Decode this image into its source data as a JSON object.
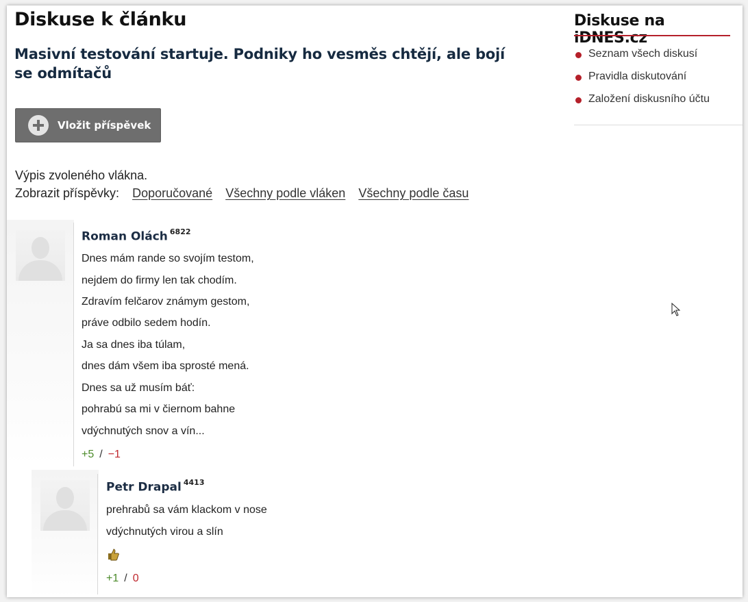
{
  "page": {
    "title": "Diskuse k článku",
    "article_title": "Masivní testování startuje. Podniky ho vesměs chtějí, ale bojí se odmítačů",
    "add_post_label": "Vložit příspěvek",
    "thread_note": "Výpis zvoleného vlákna.",
    "view_label": "Zobrazit příspěvky:",
    "view_links": [
      "Doporučované",
      "Všechny podle vláken",
      "Všechny podle času"
    ]
  },
  "comments": [
    {
      "author": "Roman Olách",
      "score": "6822",
      "lines": [
        "Dnes mám rande so svojím testom,",
        "nejdem do firmy len tak chodím.",
        "Zdravím felčarov známym gestom,",
        "práve odbilo sedem hodín.",
        "Ja sa dnes iba túlam,",
        "dnes dám všem iba sprosté mená.",
        "Dnes sa už musím báť:",
        "pohrabú sa mi v čiernom bahne",
        "vdýchnutých snov a vín..."
      ],
      "votes_plus": "+5",
      "votes_minus": "−1"
    },
    {
      "author": "Petr Drapal",
      "score": "4413",
      "lines": [
        "prehrabů sa vám klackom v nose",
        "vdýchnutých virou a slín"
      ],
      "emoji": "thumbs-up-icon",
      "votes_plus": "+1",
      "votes_minus": "0"
    }
  ],
  "sidebar": {
    "title": "Diskuse na iDNES.cz",
    "items": [
      "Seznam všech diskusí",
      "Pravidla diskutování",
      "Založení diskusního účtu"
    ],
    "accent": "#b5202a"
  },
  "colors": {
    "vote_plus": "#4b8a2a",
    "vote_minus": "#c0282e",
    "button_bg": "#6e6e6e"
  }
}
